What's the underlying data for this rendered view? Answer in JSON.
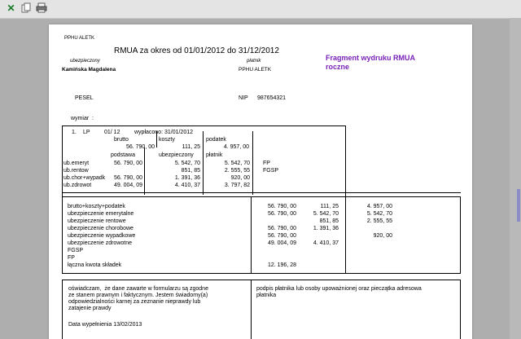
{
  "header": {
    "company": "PPHU ALETK",
    "title": "RMUA za okres od 01/01/2012 do 31/12/2012"
  },
  "annotation": {
    "line1": "Fragment wydruku RMUA",
    "line2": "roczne"
  },
  "parties": {
    "insured_label": "ubezpieczony",
    "payer_label": "płatnik",
    "insured_name": "Kamińska Magdalena",
    "payer_name": "PPHU ALETK",
    "pesel_label": "PESEL",
    "nip_label": "NIP",
    "nip_value": "987654321"
  },
  "section_label": "wymiar  :",
  "period": {
    "num": "1.",
    "type": "LP",
    "month": "01/ 12",
    "paid": "wypłacono: 31/01/2012"
  },
  "box1": {
    "headers": [
      "brutto",
      "koszty",
      "podatek"
    ],
    "values": [
      "56. 790, 00",
      "111, 25",
      "4. 957, 00"
    ],
    "subheaders": [
      "podstawa",
      "ubezpieczony",
      "płatnik"
    ],
    "rows": [
      {
        "label": "ub.emeryt",
        "base": "56. 790, 00",
        "insured": "5. 542, 70",
        "payer": "5. 542, 70",
        "extra": "FP"
      },
      {
        "label": "ub.rentow",
        "base": "",
        "insured": "851, 85",
        "payer": "2. 555, 55",
        "extra": "FGSP"
      },
      {
        "label": "ub.chor+wypadk",
        "base": "56. 790, 00",
        "insured": "1. 391, 36",
        "payer": "920, 00",
        "extra": ""
      },
      {
        "label": "ub.zdrowot",
        "base": "49. 004, 09",
        "insured": "4. 410, 37",
        "payer": "3. 797, 82",
        "extra": ""
      }
    ]
  },
  "summary": {
    "rows": [
      {
        "label": "brutto+koszty+podatek",
        "c1": "56. 790, 00",
        "c2": "111, 25",
        "c3": "4. 957, 00"
      },
      {
        "label": "ubezpieczenie emerytalne",
        "c1": "56. 790, 00",
        "c2": "5. 542, 70",
        "c3": "5. 542, 70"
      },
      {
        "label": "ubezpieczenie rentowe",
        "c1": "",
        "c2": "851, 85",
        "c3": "2. 555, 55"
      },
      {
        "label": "ubezpieczenie chorobowe",
        "c1": "56. 790, 00",
        "c2": "1. 391, 36",
        "c3": ""
      },
      {
        "label": "ubezpieczenie wypadkowe",
        "c1": "56. 790, 00",
        "c2": "",
        "c3": "920, 00"
      },
      {
        "label": "ubezpieczenie zdrowotne",
        "c1": "49. 004, 09",
        "c2": "4. 410, 37",
        "c3": ""
      },
      {
        "label": "FGSP",
        "c1": "",
        "c2": "",
        "c3": ""
      },
      {
        "label": "FP",
        "c1": "",
        "c2": "",
        "c3": ""
      },
      {
        "label": "łączna kwota składek",
        "c1": "12. 196, 28",
        "c2": "",
        "c3": ""
      }
    ]
  },
  "declaration": {
    "lines": [
      "oświadczam,  że dane zawarte w formularzu są zgodne",
      "ze stanem prawnym i faktycznym. Jestem świadomy(a)",
      "odpowiedzialności karnej za zeznanie nieprawdy lub",
      "zatajenie prawdy"
    ],
    "date": "Data wypełnienia 13/02/2013"
  },
  "signature": {
    "lines": [
      "podpis płatnika lub osoby upoważnionej oraz pieczątka adresowa",
      "płatnika"
    ]
  },
  "colors": {
    "annotation": "#7a22b8",
    "background": "#aeaeae",
    "toolbar": "#e4e4e4",
    "page": "#ffffff"
  },
  "toolbar_icons": [
    "excel-icon",
    "copy-icon",
    "print-icon"
  ]
}
